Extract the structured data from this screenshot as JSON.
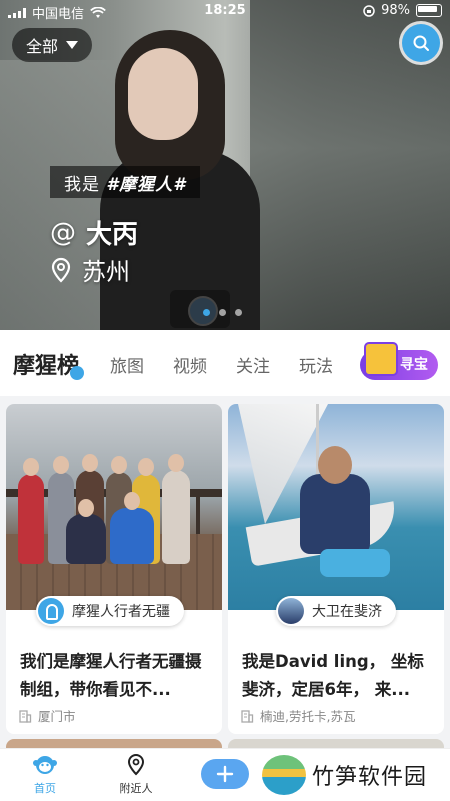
{
  "status_bar": {
    "carrier": "中国电信",
    "time": "18:25",
    "battery": "98%"
  },
  "hero": {
    "filter_label": "全部",
    "tagline_prefix": "我是",
    "tagline_tag": "#摩猩人#",
    "at_symbol": "@",
    "user_name": "大丙",
    "city": "苏州",
    "slide_count": 3,
    "active_slide": 1
  },
  "tabs": {
    "main": "摩猩榜",
    "items": [
      "旅图",
      "视频",
      "关注",
      "玩法"
    ],
    "treasure_label": "寻宝"
  },
  "cards": [
    {
      "author": "摩猩人行者无疆",
      "title": "我们是摩猩人行者无疆摄制组，带你看见不...",
      "location": "厦门市"
    },
    {
      "author": "大卫在斐济",
      "title": "我是David ling， 坐标斐济，定居6年，  来...",
      "location": "楠迪,劳托卡,苏瓦"
    }
  ],
  "bottom_nav": {
    "home": "首页",
    "nearby": "附近人",
    "add": "+"
  },
  "watermark": {
    "text": "竹笋软件园"
  },
  "colors": {
    "accent": "#3ea6e6",
    "treasure": "#7b3fe4"
  }
}
